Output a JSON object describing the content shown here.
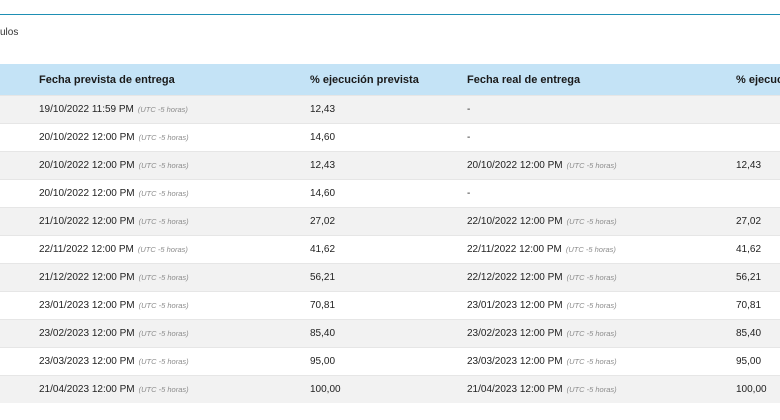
{
  "caption": "ulos",
  "table": {
    "headers": [
      "",
      "Fecha prevista de entrega",
      "% ejecución prevista",
      "Fecha real de entrega",
      "% ejecuc"
    ],
    "rows": [
      {
        "planned_date": "19/10/2022 11:59 PM",
        "planned_tz": "(UTC -5 horas)",
        "planned_pct": "12,43",
        "actual_date": "-",
        "actual_tz": "",
        "actual_pct": ""
      },
      {
        "planned_date": "20/10/2022 12:00 PM",
        "planned_tz": "(UTC -5 horas)",
        "planned_pct": "14,60",
        "actual_date": "-",
        "actual_tz": "",
        "actual_pct": ""
      },
      {
        "planned_date": "20/10/2022 12:00 PM",
        "planned_tz": "(UTC -5 horas)",
        "planned_pct": "12,43",
        "actual_date": "20/10/2022 12:00 PM",
        "actual_tz": "(UTC -5 horas)",
        "actual_pct": "12,43"
      },
      {
        "planned_date": "20/10/2022 12:00 PM",
        "planned_tz": "(UTC -5 horas)",
        "planned_pct": "14,60",
        "actual_date": "-",
        "actual_tz": "",
        "actual_pct": ""
      },
      {
        "planned_date": "21/10/2022 12:00 PM",
        "planned_tz": "(UTC -5 horas)",
        "planned_pct": "27,02",
        "actual_date": "22/10/2022 12:00 PM",
        "actual_tz": "(UTC -5 horas)",
        "actual_pct": "27,02"
      },
      {
        "planned_date": "22/11/2022 12:00 PM",
        "planned_tz": "(UTC -5 horas)",
        "planned_pct": "41,62",
        "actual_date": "22/11/2022 12:00 PM",
        "actual_tz": "(UTC -5 horas)",
        "actual_pct": "41,62"
      },
      {
        "planned_date": "21/12/2022 12:00 PM",
        "planned_tz": "(UTC -5 horas)",
        "planned_pct": "56,21",
        "actual_date": "22/12/2022 12:00 PM",
        "actual_tz": "(UTC -5 horas)",
        "actual_pct": "56,21"
      },
      {
        "planned_date": "23/01/2023 12:00 PM",
        "planned_tz": "(UTC -5 horas)",
        "planned_pct": "70,81",
        "actual_date": "23/01/2023 12:00 PM",
        "actual_tz": "(UTC -5 horas)",
        "actual_pct": "70,81"
      },
      {
        "planned_date": "23/02/2023 12:00 PM",
        "planned_tz": "(UTC -5 horas)",
        "planned_pct": "85,40",
        "actual_date": "23/02/2023 12:00 PM",
        "actual_tz": "(UTC -5 horas)",
        "actual_pct": "85,40"
      },
      {
        "planned_date": "23/03/2023 12:00 PM",
        "planned_tz": "(UTC -5 horas)",
        "planned_pct": "95,00",
        "actual_date": "23/03/2023 12:00 PM",
        "actual_tz": "(UTC -5 horas)",
        "actual_pct": "95,00"
      },
      {
        "planned_date": "21/04/2023 12:00 PM",
        "planned_tz": "(UTC -5 horas)",
        "planned_pct": "100,00",
        "actual_date": "21/04/2023 12:00 PM",
        "actual_tz": "(UTC -5 horas)",
        "actual_pct": "100,00"
      }
    ]
  },
  "colors": {
    "accent_rule": "#1e8fb4",
    "header_background": "#c4e3f6",
    "stripe_background": "#f2f2f2",
    "timezone_text": "#8c8c8c"
  }
}
